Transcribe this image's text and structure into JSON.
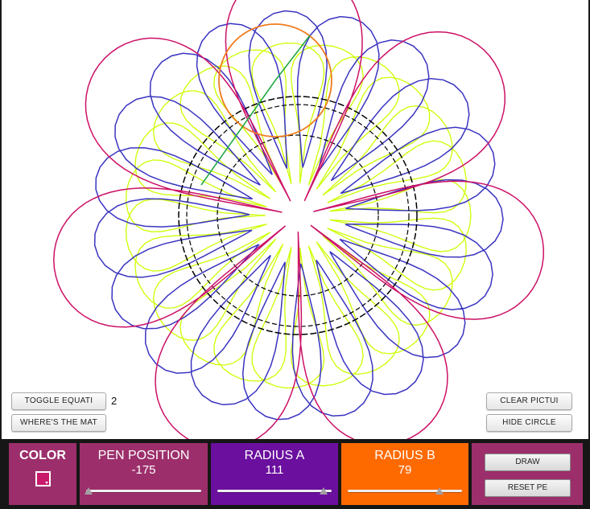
{
  "toolbar": {
    "toggle_equation_label": "TOGGLE EQUATI",
    "wheres_math_label": "WHERE'S THE MAT",
    "equation_number": "2",
    "clear_picture_label": "CLEAR PICTUI",
    "hide_circles_label": "HIDE CIRCLE"
  },
  "controls": {
    "color": {
      "label": "COLOR",
      "swatch_color": "#c8196b",
      "panel_color": "#9c2f6b"
    },
    "pen_position": {
      "label": "PEN POSITION",
      "value": "-175",
      "panel_color": "#9c2f6b",
      "slider_fraction": 0.02
    },
    "radius_a": {
      "label": "RADIUS A",
      "value": "111",
      "panel_color": "#6a0f9e",
      "slider_fraction": 0.93
    },
    "radius_b": {
      "label": "RADIUS B",
      "value": "79",
      "panel_color": "#fe6a00",
      "slider_fraction": 0.8
    },
    "actions": {
      "draw_label": "DRAW",
      "reset_label": "RESET PE",
      "panel_color": "#9c2f6b"
    }
  },
  "colors": {
    "curve_yellow": "#ccff00",
    "curve_blue": "#3a34c0",
    "curve_magenta": "#cc1166",
    "circle_black": "#000000",
    "circle_orange": "#f07c1e",
    "arm_green": "#22aa44"
  }
}
